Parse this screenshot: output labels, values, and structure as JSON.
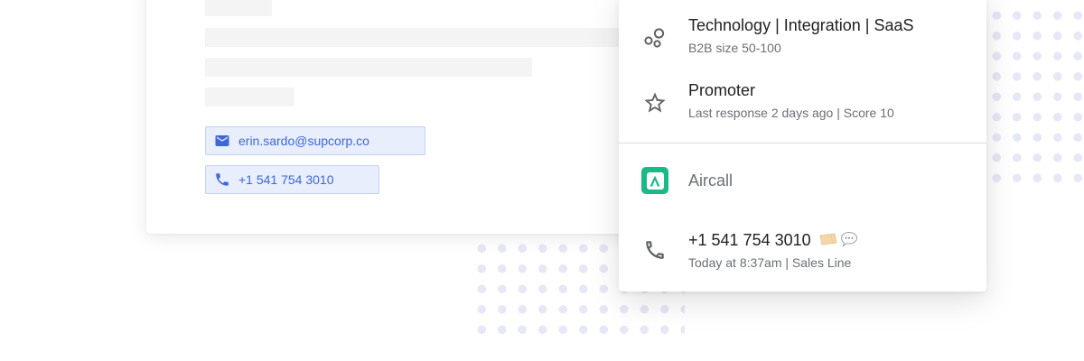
{
  "contact": {
    "email": "erin.sardo@supcorp.co",
    "phone": "+1 541 754 3010"
  },
  "insights": {
    "industry": {
      "title": "Technology | Integration | SaaS",
      "subtitle": "B2B size 50-100",
      "icon": "segments-icon"
    },
    "nps": {
      "title": "Promoter",
      "subtitle": "Last response 2 days ago | Score 10",
      "icon": "star-outline-icon"
    }
  },
  "integration": {
    "name": "Aircall",
    "icon": "aircall-logo"
  },
  "call": {
    "number": "+1 541 754 3010",
    "detail": "Today at 8:37am | Sales Line",
    "icon": "phone-icon",
    "emojis": [
      "ticket-icon",
      "speech-bubble-icon"
    ]
  },
  "colors": {
    "chip_bg": "#e8eefc",
    "chip_text": "#3f67d7",
    "aircall_green": "#1bb888",
    "dots": "#e6e8f7"
  }
}
